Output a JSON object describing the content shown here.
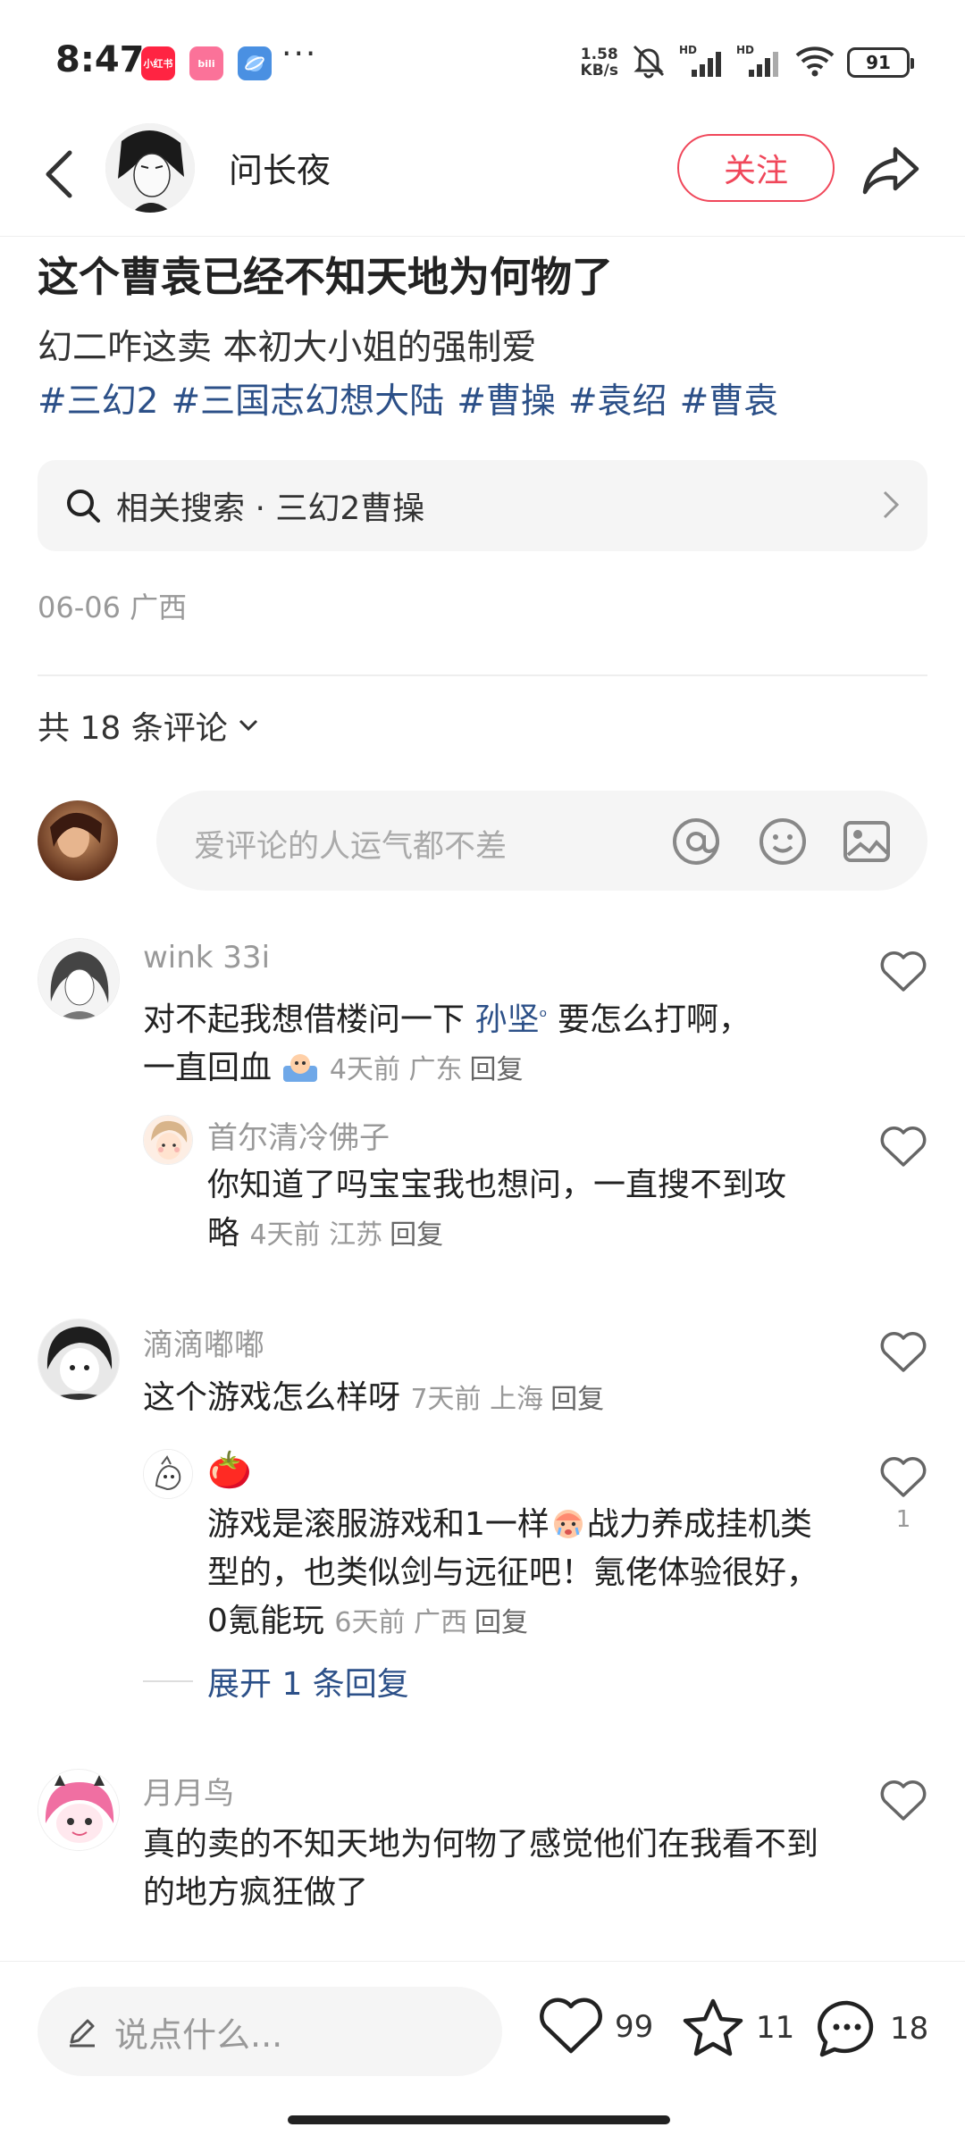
{
  "status_bar": {
    "time": "8:47",
    "apps": [
      "小红书",
      "bilibili",
      "browser"
    ],
    "more": "···",
    "net_speed_value": "1.58",
    "net_speed_unit": "KB/s",
    "signal_labels": [
      "HD",
      "HD"
    ],
    "battery": "91"
  },
  "header": {
    "author_name": "问长夜",
    "follow_label": "关注"
  },
  "post": {
    "title": "这个曹袁已经不知天地为何物了",
    "body": "幻二咋这卖 本初大小姐的强制爱",
    "tags": [
      "#三幻2",
      "#三国志幻想大陆",
      "#曹操",
      "#袁绍",
      "#曹袁"
    ],
    "related_search": "相关搜索 · 三幻2曹操",
    "meta": "06-06 广西"
  },
  "comments_section": {
    "count_label": "共 18 条评论",
    "input_placeholder": "爱评论的人运气都不差"
  },
  "comments": [
    {
      "name": "wink 33i",
      "text_before": "对不起我想借楼问一下 ",
      "mention": "孙坚",
      "text_after": " 要怎么打啊，",
      "text_line2": "一直回血",
      "meta": "4天前 广东",
      "reply": "回复"
    },
    {
      "name": "首尔清冷佛子",
      "text": "你知道了吗宝宝我也想问，一直搜不到攻略",
      "meta": "4天前 江苏",
      "reply": "回复"
    },
    {
      "name": "滴滴嘟嘟",
      "text": "这个游戏怎么样呀",
      "meta": "7天前 上海",
      "reply": "回复"
    },
    {
      "name": "🍅",
      "text": "游戏是滚服游戏和1一样",
      "text_after_emoji": "战力养成挂机类型的，也类似剑与远征吧！氪佬体验很好，0氪能玩",
      "meta": "6天前 广西",
      "reply": "回复",
      "likes": "1"
    },
    {
      "name": "月月鸟",
      "text": "真的卖的不知天地为何物了感觉他们在我看不到的地方疯狂做了"
    }
  ],
  "expand_replies": "展开 1 条回复",
  "bottom_bar": {
    "say_placeholder": "说点什么...",
    "likes": "99",
    "stars": "11",
    "comments": "18"
  },
  "colors": {
    "accent_red": "#f0475a",
    "link_blue": "#2c5088",
    "xhs_red": "#ff2442",
    "bili_pink": "#fb7299",
    "browser_blue": "#4a90e2"
  }
}
